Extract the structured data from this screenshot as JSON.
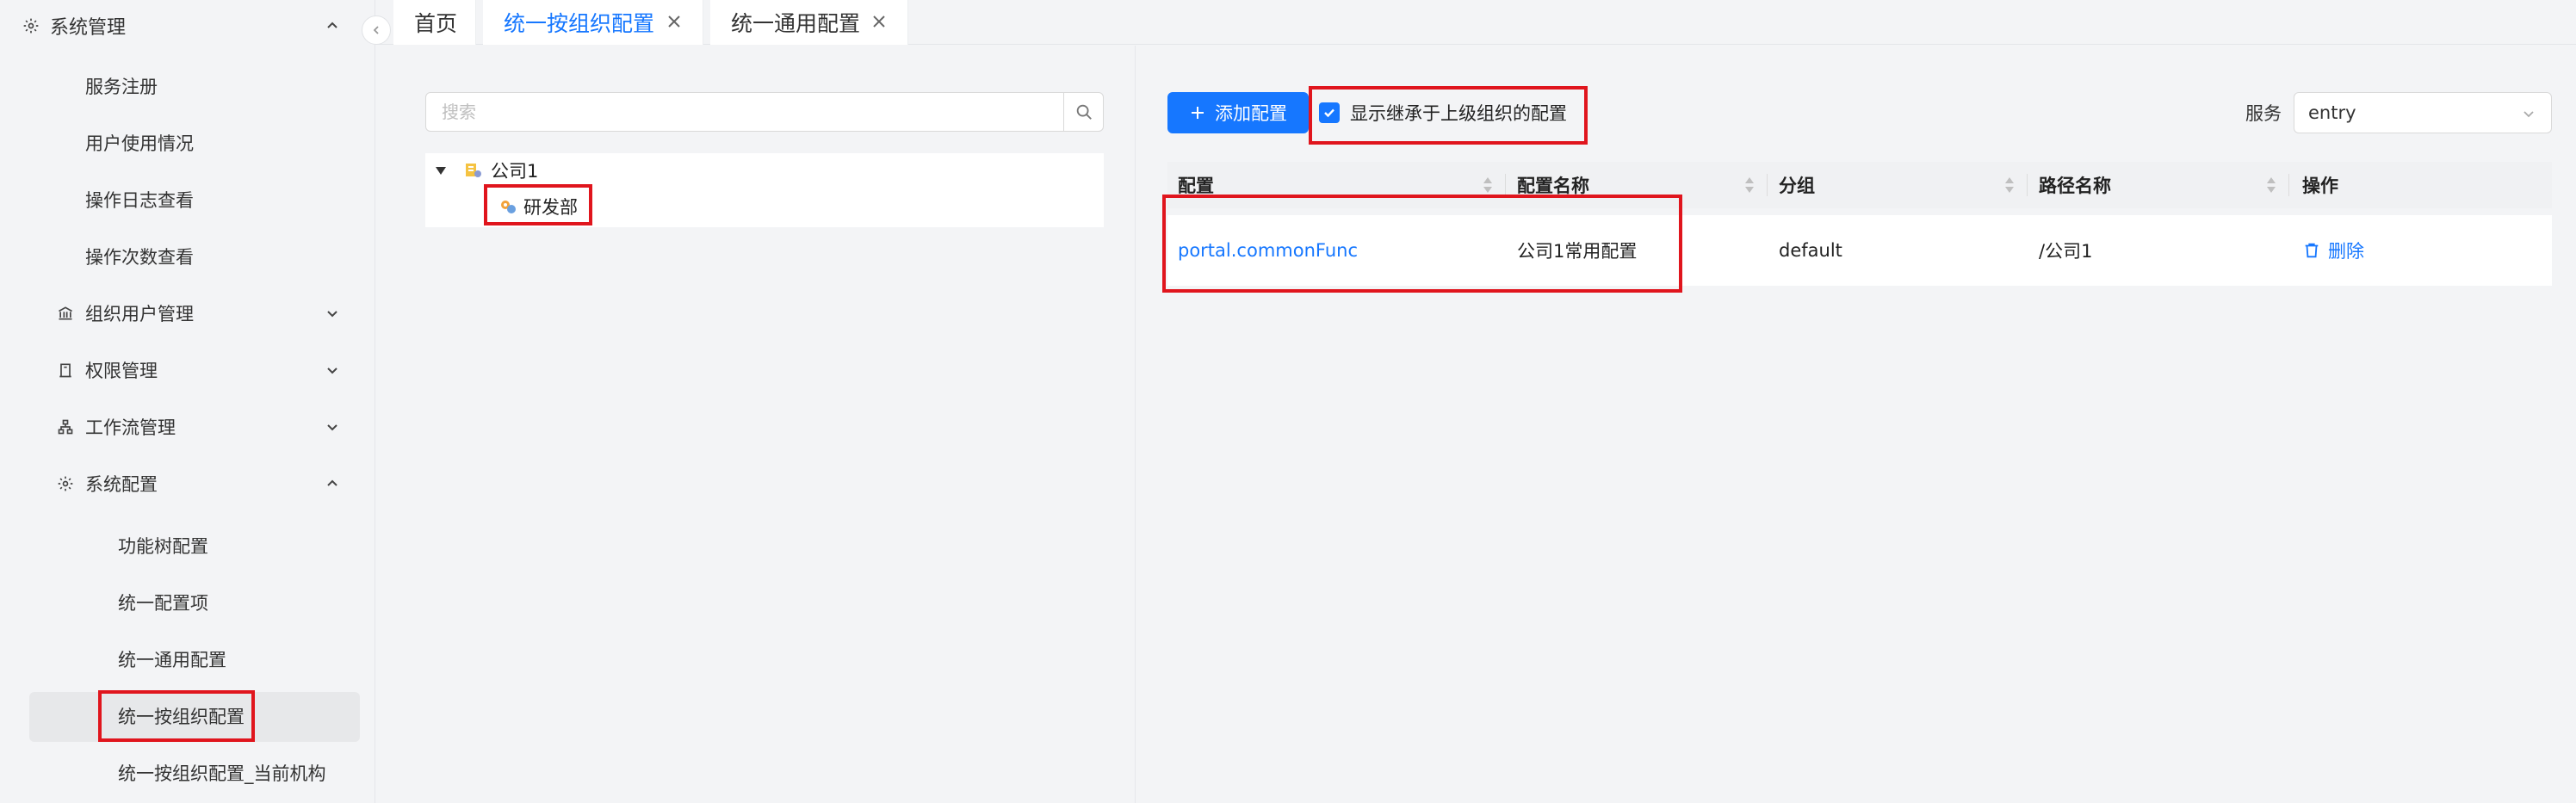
{
  "sidebar": {
    "title": "系统管理",
    "items": [
      {
        "label": "服务注册"
      },
      {
        "label": "用户使用情况"
      },
      {
        "label": "操作日志查看"
      },
      {
        "label": "操作次数查看"
      },
      {
        "label": "组织用户管理"
      },
      {
        "label": "权限管理"
      },
      {
        "label": "工作流管理"
      },
      {
        "label": "系统配置"
      },
      {
        "label": "功能树配置"
      },
      {
        "label": "统一配置项"
      },
      {
        "label": "统一通用配置"
      },
      {
        "label": "统一按组织配置"
      },
      {
        "label": "统一按组织配置_当前机构"
      }
    ]
  },
  "tabs": [
    {
      "label": "首页"
    },
    {
      "label": "统一按组织配置"
    },
    {
      "label": "统一通用配置"
    }
  ],
  "tree": {
    "search_placeholder": "搜索",
    "root": "公司1",
    "child": "研发部"
  },
  "toolbar": {
    "add_label": "添加配置",
    "inherit_label": "显示继承于上级组织的配置",
    "service_label": "服务",
    "service_value": "entry"
  },
  "table": {
    "headers": [
      "配置",
      "配置名称",
      "分组",
      "路径名称",
      "操作"
    ],
    "rows": [
      {
        "config": "portal.commonFunc",
        "name": "公司1常用配置",
        "group": "default",
        "path": "/公司1",
        "action": "删除"
      }
    ]
  },
  "colors": {
    "accent": "#1677ff",
    "highlight": "#e0151d"
  }
}
